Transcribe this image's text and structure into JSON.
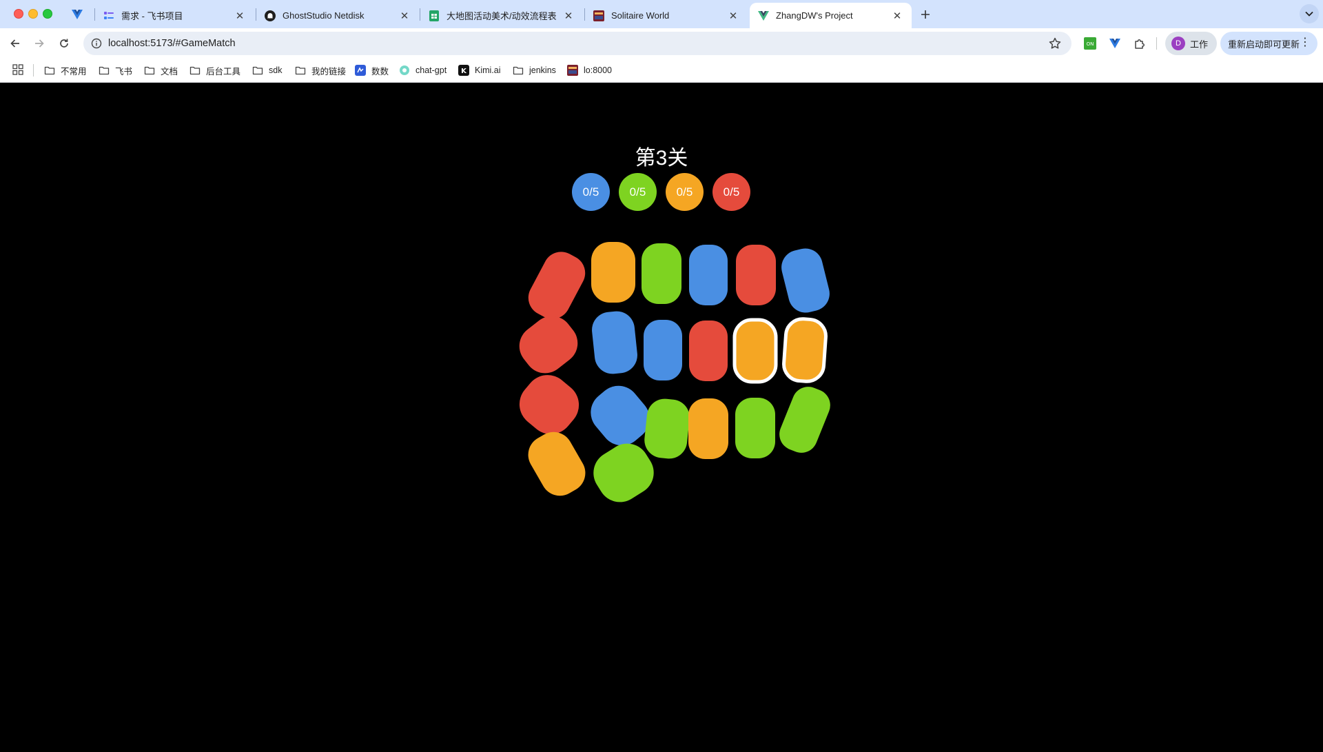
{
  "colors": {
    "blue": "#4a8fe3",
    "green": "#7ed321",
    "orange": "#f5a623",
    "red": "#e54b3c",
    "selected_outline": "#ffffff"
  },
  "browser": {
    "tabs": [
      {
        "title": "需求 - 飞书项目",
        "icon": "feishu-project-icon"
      },
      {
        "title": "GhostStudio Netdisk",
        "icon": "ghost-icon"
      },
      {
        "title": "大地图活动美术/动效流程表 - G",
        "icon": "google-sheets-icon"
      },
      {
        "title": "Solitaire World",
        "icon": "solitaire-icon"
      },
      {
        "title": "ZhangDW's Project",
        "icon": "vue-icon",
        "active": true
      }
    ],
    "address": "localhost:5173/#GameMatch",
    "profile_initial": "D",
    "profile_label": "工作",
    "update_label": "重新启动即可更新"
  },
  "bookmarks": [
    {
      "label": "不常用",
      "icon": "folder-icon"
    },
    {
      "label": "飞书",
      "icon": "folder-icon"
    },
    {
      "label": "文档",
      "icon": "folder-icon"
    },
    {
      "label": "后台工具",
      "icon": "folder-icon"
    },
    {
      "label": "sdk",
      "icon": "folder-icon"
    },
    {
      "label": "我的链接",
      "icon": "folder-icon"
    },
    {
      "label": "数数",
      "icon": "shushu-icon"
    },
    {
      "label": "chat-gpt",
      "icon": "chatgpt-icon"
    },
    {
      "label": "Kimi.ai",
      "icon": "kimi-icon"
    },
    {
      "label": "jenkins",
      "icon": "folder-icon"
    },
    {
      "label": "lo:8000",
      "icon": "game-icon"
    }
  ],
  "game": {
    "level_title": "第3关",
    "counters": [
      {
        "color": "blue",
        "text": "0/5"
      },
      {
        "color": "green",
        "text": "0/5"
      },
      {
        "color": "orange",
        "text": "0/5"
      },
      {
        "color": "red",
        "text": "0/5"
      }
    ],
    "pieces": [
      {
        "color": "red",
        "selected": false
      },
      {
        "color": "orange",
        "selected": false
      },
      {
        "color": "green",
        "selected": false
      },
      {
        "color": "blue",
        "selected": false
      },
      {
        "color": "red",
        "selected": false
      },
      {
        "color": "blue",
        "selected": false
      },
      {
        "color": "red",
        "selected": false
      },
      {
        "color": "blue",
        "selected": false
      },
      {
        "color": "blue",
        "selected": false
      },
      {
        "color": "red",
        "selected": false
      },
      {
        "color": "orange",
        "selected": true
      },
      {
        "color": "orange",
        "selected": true
      },
      {
        "color": "red",
        "selected": false
      },
      {
        "color": "blue",
        "selected": false
      },
      {
        "color": "green",
        "selected": false
      },
      {
        "color": "orange",
        "selected": false
      },
      {
        "color": "green",
        "selected": false
      },
      {
        "color": "green",
        "selected": false
      },
      {
        "color": "orange",
        "selected": false
      },
      {
        "color": "green",
        "selected": false
      }
    ]
  }
}
